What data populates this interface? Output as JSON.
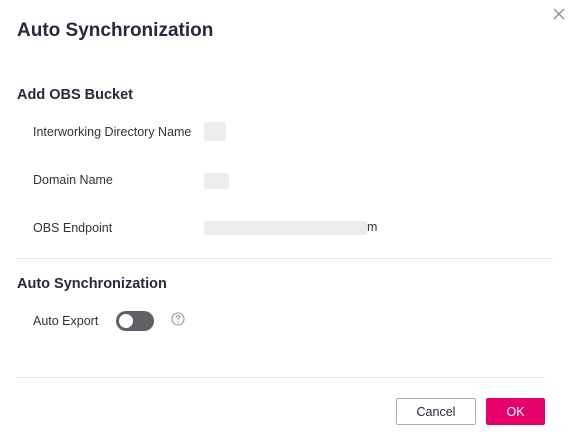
{
  "dialog": {
    "title": "Auto Synchronization"
  },
  "obs_section": {
    "title": "Add OBS Bucket",
    "fields": [
      {
        "label": "Interworking Directory Name",
        "value": ""
      },
      {
        "label": "Domain Name",
        "value": ""
      },
      {
        "label": "OBS Endpoint",
        "value_suffix": "m"
      }
    ]
  },
  "sync_section": {
    "title": "Auto Synchronization",
    "auto_export_label": "Auto Export",
    "auto_export_enabled": false
  },
  "footer": {
    "cancel_label": "Cancel",
    "ok_label": "OK"
  },
  "colors": {
    "primary": "#e6006b",
    "toggle_off": "#5e6166",
    "divider": "#e6e6e6"
  },
  "icons": {
    "close": "close-icon",
    "help": "help-icon"
  }
}
